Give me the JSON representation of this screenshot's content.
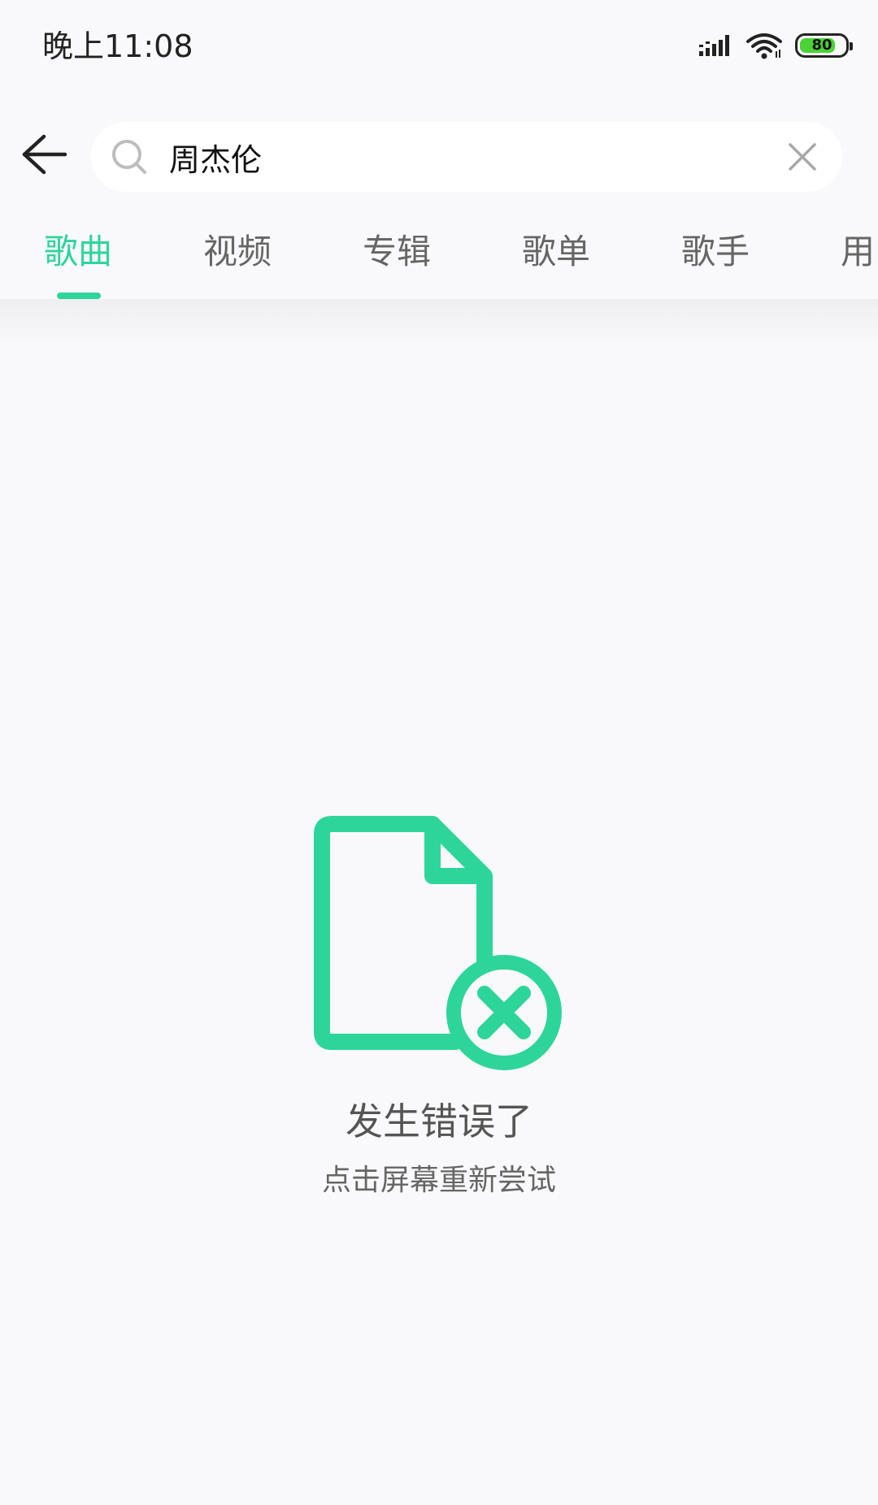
{
  "status_bar": {
    "time": "晚上11:08",
    "battery_level": "80",
    "battery_fraction": 0.8,
    "battery_color": "#4cd137"
  },
  "search": {
    "value": "周杰伦",
    "back_icon": "back-arrow-icon",
    "search_icon": "search-icon",
    "clear_icon": "close-icon"
  },
  "tabs": [
    {
      "label": "歌曲",
      "active": true
    },
    {
      "label": "视频",
      "active": false
    },
    {
      "label": "专辑",
      "active": false
    },
    {
      "label": "歌单",
      "active": false
    },
    {
      "label": "歌手",
      "active": false
    },
    {
      "label": "用",
      "active": false
    }
  ],
  "error": {
    "icon": "file-error-icon",
    "title": "发生错误了",
    "subtitle": "点击屏幕重新尝试"
  },
  "colors": {
    "accent": "#2ed59a",
    "background": "#f9f9fb"
  }
}
